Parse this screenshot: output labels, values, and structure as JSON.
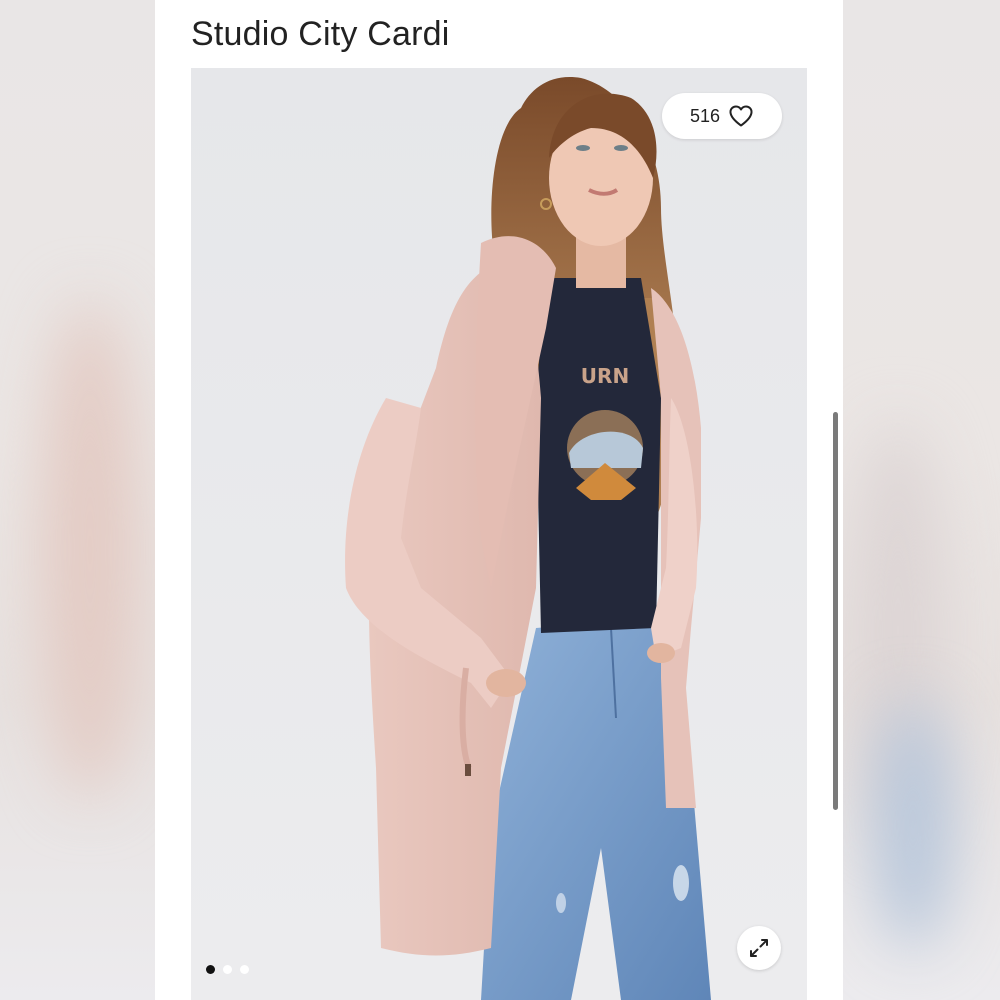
{
  "product": {
    "title": "Studio City Cardi"
  },
  "gallery": {
    "likes_count": "516",
    "slide_count": 3,
    "active_slide": 0
  },
  "icons": {
    "like": "heart-outline-icon",
    "expand": "expand-arrows-icon"
  },
  "colors": {
    "cardigan": "#e8c6bd",
    "tee": "#23283a",
    "jeans": "#7ea3cf",
    "hair": "#8a5a34",
    "photo_bg": "#e8e8ea"
  }
}
